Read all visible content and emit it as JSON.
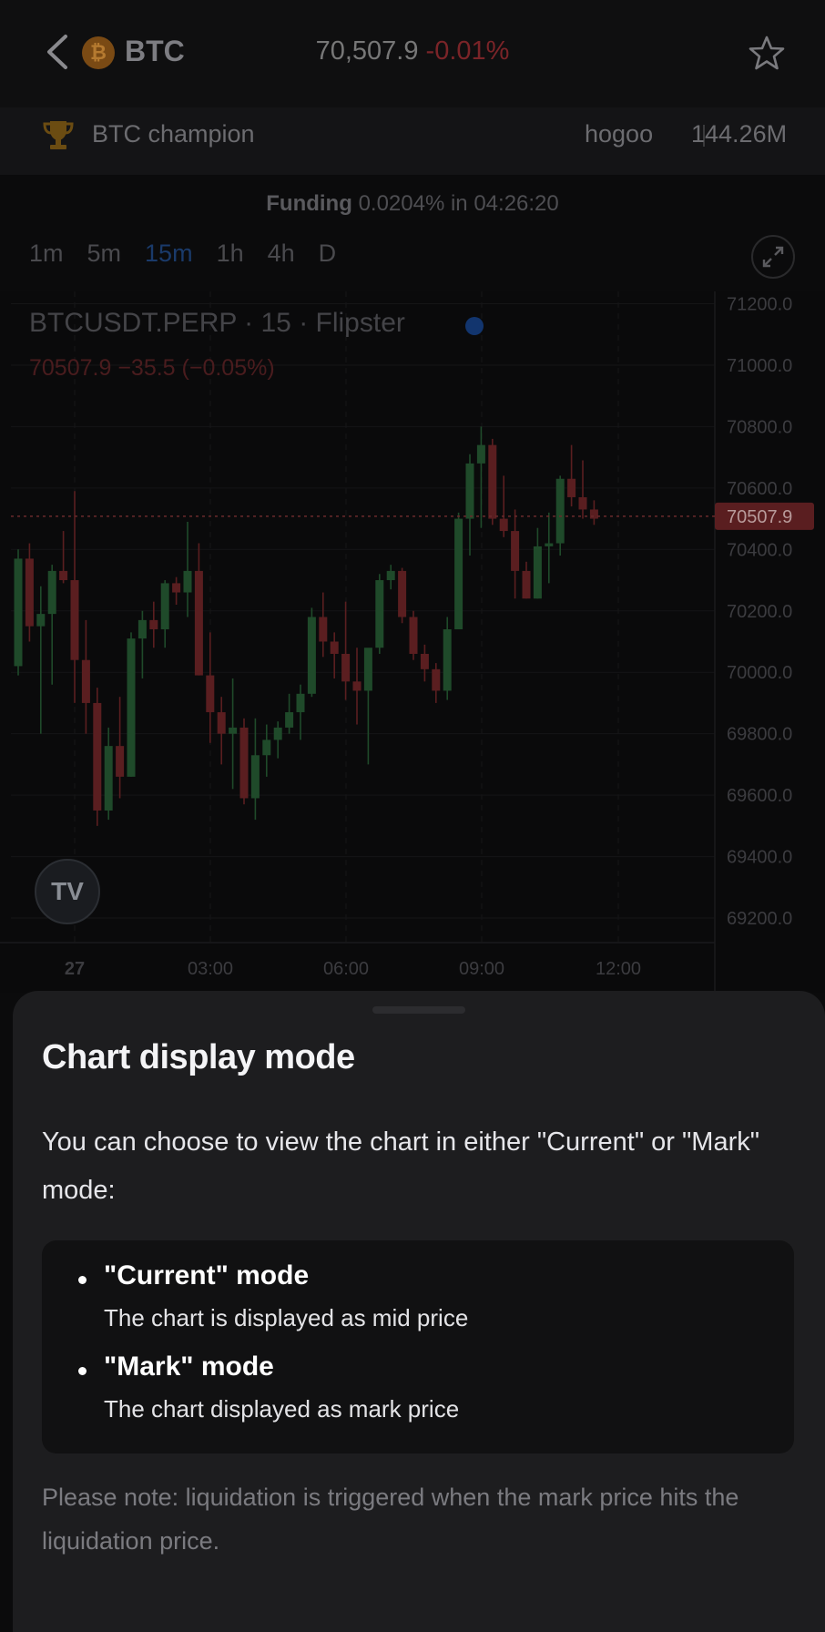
{
  "header": {
    "symbol": "BTC",
    "coin_badge": "₿",
    "price": "70,507.9",
    "price_change": "-0.01%"
  },
  "champion": {
    "label": "BTC champion",
    "user": "hogoo",
    "volume": "144.26M"
  },
  "funding": {
    "label": "Funding",
    "text": "0.0204% in 04:26:20"
  },
  "timeframes": [
    {
      "label": "1m",
      "active": false
    },
    {
      "label": "5m",
      "active": false
    },
    {
      "label": "15m",
      "active": true
    },
    {
      "label": "1h",
      "active": false
    },
    {
      "label": "4h",
      "active": false
    },
    {
      "label": "D",
      "active": false
    }
  ],
  "chart_header": {
    "title": "BTCUSDT.PERP · 15 · Flipster",
    "quote": "70507.9  −35.5 (−0.05%)"
  },
  "tv_logo": "TV",
  "chart_data": {
    "type": "candlestick",
    "y_ticks": [
      71200.0,
      71000.0,
      70800.0,
      70600.0,
      70400.0,
      70200.0,
      70000.0,
      69800.0,
      69600.0,
      69400.0,
      69200.0
    ],
    "ylim": [
      69120,
      71240
    ],
    "x_tick_labels": [
      "27",
      "03:00",
      "06:00",
      "09:00",
      "12:00"
    ],
    "last_price": "70507.9",
    "colors": {
      "up": "#1f4a2a",
      "down": "#5a1e20",
      "last_line": "#6b2a2c"
    },
    "candles": [
      {
        "o": 70020,
        "h": 70400,
        "l": 69990,
        "c": 70370
      },
      {
        "o": 70370,
        "h": 70420,
        "l": 70100,
        "c": 70150
      },
      {
        "o": 70150,
        "h": 70280,
        "l": 69800,
        "c": 70190
      },
      {
        "o": 70190,
        "h": 70350,
        "l": 69960,
        "c": 70330
      },
      {
        "o": 70330,
        "h": 70460,
        "l": 70290,
        "c": 70300
      },
      {
        "o": 70300,
        "h": 70590,
        "l": 69900,
        "c": 70040
      },
      {
        "o": 70040,
        "h": 70170,
        "l": 69800,
        "c": 69900
      },
      {
        "o": 69900,
        "h": 69950,
        "l": 69500,
        "c": 69550
      },
      {
        "o": 69550,
        "h": 69820,
        "l": 69520,
        "c": 69760
      },
      {
        "o": 69760,
        "h": 69920,
        "l": 69590,
        "c": 69660
      },
      {
        "o": 69660,
        "h": 70130,
        "l": 69660,
        "c": 70110
      },
      {
        "o": 70110,
        "h": 70200,
        "l": 69980,
        "c": 70170
      },
      {
        "o": 70170,
        "h": 70230,
        "l": 70080,
        "c": 70140
      },
      {
        "o": 70140,
        "h": 70300,
        "l": 70080,
        "c": 70290
      },
      {
        "o": 70290,
        "h": 70310,
        "l": 70220,
        "c": 70260
      },
      {
        "o": 70260,
        "h": 70490,
        "l": 70180,
        "c": 70330
      },
      {
        "o": 70330,
        "h": 70420,
        "l": 69990,
        "c": 69990
      },
      {
        "o": 69990,
        "h": 70130,
        "l": 69770,
        "c": 69870
      },
      {
        "o": 69870,
        "h": 69920,
        "l": 69700,
        "c": 69800
      },
      {
        "o": 69800,
        "h": 69980,
        "l": 69620,
        "c": 69820
      },
      {
        "o": 69820,
        "h": 69850,
        "l": 69570,
        "c": 69590
      },
      {
        "o": 69590,
        "h": 69850,
        "l": 69520,
        "c": 69730
      },
      {
        "o": 69730,
        "h": 69830,
        "l": 69660,
        "c": 69780
      },
      {
        "o": 69780,
        "h": 69840,
        "l": 69720,
        "c": 69820
      },
      {
        "o": 69820,
        "h": 69930,
        "l": 69800,
        "c": 69870
      },
      {
        "o": 69870,
        "h": 69960,
        "l": 69780,
        "c": 69930
      },
      {
        "o": 69930,
        "h": 70210,
        "l": 69920,
        "c": 70180
      },
      {
        "o": 70180,
        "h": 70260,
        "l": 70050,
        "c": 70100
      },
      {
        "o": 70100,
        "h": 70130,
        "l": 69980,
        "c": 70060
      },
      {
        "o": 70060,
        "h": 70230,
        "l": 69910,
        "c": 69970
      },
      {
        "o": 69970,
        "h": 70080,
        "l": 69830,
        "c": 69940
      },
      {
        "o": 69940,
        "h": 70070,
        "l": 69700,
        "c": 70080
      },
      {
        "o": 70080,
        "h": 70320,
        "l": 70060,
        "c": 70300
      },
      {
        "o": 70300,
        "h": 70350,
        "l": 70270,
        "c": 70330
      },
      {
        "o": 70330,
        "h": 70340,
        "l": 70160,
        "c": 70180
      },
      {
        "o": 70180,
        "h": 70200,
        "l": 70040,
        "c": 70060
      },
      {
        "o": 70060,
        "h": 70090,
        "l": 69970,
        "c": 70010
      },
      {
        "o": 70010,
        "h": 70030,
        "l": 69900,
        "c": 69940
      },
      {
        "o": 69940,
        "h": 70180,
        "l": 69910,
        "c": 70140
      },
      {
        "o": 70140,
        "h": 70520,
        "l": 70140,
        "c": 70500
      },
      {
        "o": 70500,
        "h": 70710,
        "l": 70380,
        "c": 70680
      },
      {
        "o": 70680,
        "h": 70800,
        "l": 70470,
        "c": 70740
      },
      {
        "o": 70740,
        "h": 70760,
        "l": 70480,
        "c": 70500
      },
      {
        "o": 70500,
        "h": 70640,
        "l": 70440,
        "c": 70460
      },
      {
        "o": 70460,
        "h": 70530,
        "l": 70240,
        "c": 70330
      },
      {
        "o": 70330,
        "h": 70360,
        "l": 70240,
        "c": 70240
      },
      {
        "o": 70240,
        "h": 70470,
        "l": 70240,
        "c": 70410
      },
      {
        "o": 70410,
        "h": 70520,
        "l": 70290,
        "c": 70420
      },
      {
        "o": 70420,
        "h": 70640,
        "l": 70380,
        "c": 70630
      },
      {
        "o": 70630,
        "h": 70740,
        "l": 70540,
        "c": 70570
      },
      {
        "o": 70570,
        "h": 70690,
        "l": 70500,
        "c": 70530
      },
      {
        "o": 70530,
        "h": 70560,
        "l": 70480,
        "c": 70500
      }
    ]
  },
  "sheet": {
    "title": "Chart display mode",
    "intro": "You can choose to view the chart in either \"Current\" or \"Mark\" mode:",
    "modes": [
      {
        "title": "\"Current\" mode",
        "desc": "The chart is displayed as mid price"
      },
      {
        "title": "\"Mark\" mode",
        "desc": "The chart displayed as mark price"
      }
    ],
    "note": "Please note: liquidation is triggered when the mark price hits the liquidation price."
  }
}
